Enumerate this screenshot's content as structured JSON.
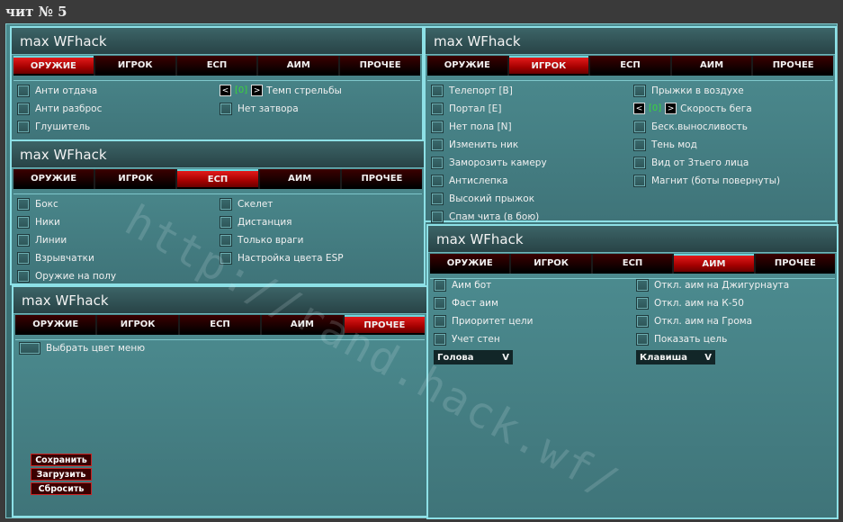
{
  "page_title": "чит № 5",
  "app_title": "max WFhack",
  "tabs": [
    "ОРУЖИЕ",
    "ИГРОК",
    "ЕСП",
    "АИМ",
    "ПРОЧЕЕ"
  ],
  "weapon": {
    "options": [
      "Анти отдача",
      "Анти разброс",
      "Глушитель",
      "Нет затвора"
    ],
    "stepper": {
      "left": "<",
      "value": "[0]",
      "right": ">",
      "label": "Темп стрельбы"
    }
  },
  "player": {
    "left": [
      "Телепорт [B]",
      "Портал [E]",
      "Нет пола [N]",
      "Изменить ник",
      "Заморозить камеру",
      "Антислепка",
      "Высокий прыжок",
      "Спам чита (в бою)"
    ],
    "right": [
      "Прыжки в воздухе",
      "Беск.выносливость",
      "Тень мод",
      "Вид от 3тьего лица",
      "Магнит (боты повернуты)"
    ],
    "stepper": {
      "left": "<",
      "value": "[0]",
      "right": ">",
      "label": "Скорость бега"
    }
  },
  "esp": {
    "left": [
      "Бокс",
      "Ники",
      "Линии",
      "Взрывчатки",
      "Оружие на полу"
    ],
    "right": [
      "Скелет",
      "Дистанция",
      "Только враги",
      "Настройка цвета ESP"
    ]
  },
  "aim": {
    "left": [
      "Аим бот",
      "Фаст аим",
      "Приоритет цели",
      "Учет стен"
    ],
    "right": [
      "Откл. аим на Джигурнаута",
      "Откл. аим на К-50",
      "Откл. аим на Грома",
      "Показать цель"
    ],
    "dropdown_target": "Голова",
    "dropdown_key": "Клавиша",
    "caret": "V"
  },
  "misc": {
    "option": "Выбрать цвет меню",
    "buttons": [
      "Сохранить",
      "Загрузить",
      "Сбросить"
    ]
  },
  "watermark": "http://rand.hack.wf/"
}
